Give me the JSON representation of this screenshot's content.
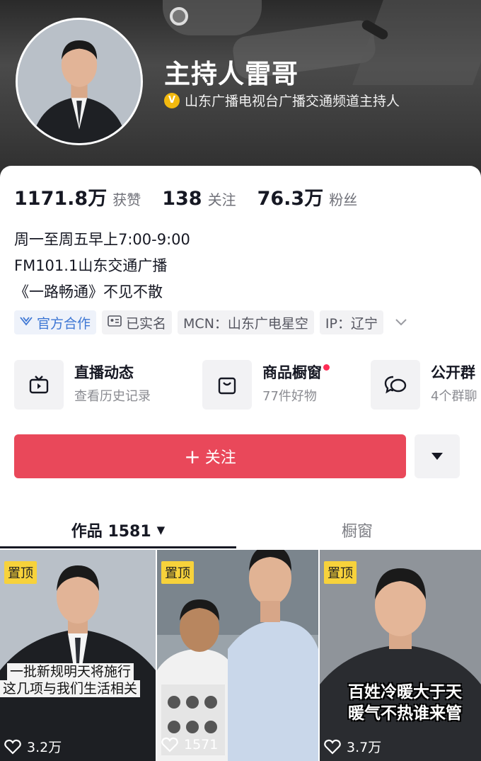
{
  "profile": {
    "name": "主持人雷哥",
    "verify_badge": "V",
    "verify_text": "山东广播电视台广播交通频道主持人"
  },
  "stats": [
    {
      "value": "1171.8万",
      "label": "获赞"
    },
    {
      "value": "138",
      "label": "关注"
    },
    {
      "value": "76.3万",
      "label": "粉丝"
    }
  ],
  "bio": {
    "line1": "周一至周五早上7:00-9:00",
    "line2": "FM101.1山东交通广播",
    "line3": "《一路畅通》不见不散"
  },
  "tags": {
    "official": "官方合作",
    "realname": "已实名",
    "mcn": "MCN：山东广电星空",
    "ip": "IP：辽宁"
  },
  "features": [
    {
      "title": "直播动态",
      "sub": "查看历史记录",
      "icon": "tv-icon"
    },
    {
      "title": "商品橱窗",
      "sub": "77件好物",
      "icon": "shopping-bag-icon"
    },
    {
      "title": "公开群",
      "sub": "4个群聊",
      "icon": "chat-bubbles-icon"
    }
  ],
  "actions": {
    "follow_plus": "+",
    "follow_label": "关注"
  },
  "tabs": {
    "works_label": "作品 1581",
    "showcase_label": "橱窗"
  },
  "videos": [
    {
      "pin": "置顶",
      "caption1": "一批新规明天将施行",
      "caption2": "这几项与我们生活相关",
      "likes": "3.2万"
    },
    {
      "pin": "置顶",
      "likes": "1571"
    },
    {
      "pin": "置顶",
      "caption1": "百姓冷暖大于天",
      "caption2": "暖气不热谁来管",
      "likes": "3.7万"
    }
  ],
  "colors": {
    "follow_button": "#e9485a",
    "verify_badge": "#f2b90f",
    "pin_badge": "#f7d23b",
    "official_tag": "#3e77d4"
  }
}
